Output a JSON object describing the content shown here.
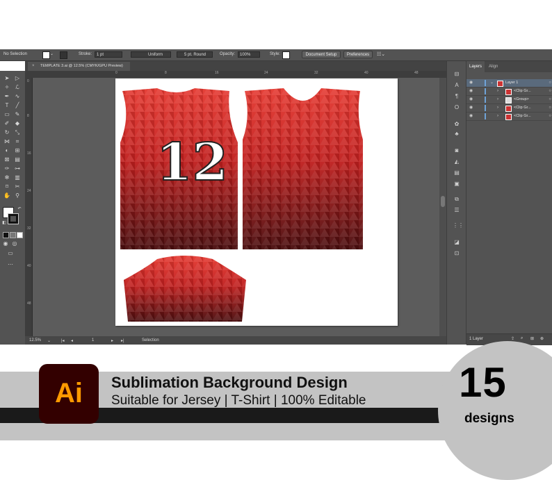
{
  "control_bar": {
    "selection": "No Selection",
    "stroke_label": "Stroke:",
    "stroke_value": "1 pt",
    "stroke_style": "Uniform",
    "brush": "5 pt. Round",
    "opacity_label": "Opacity:",
    "opacity_value": "100%",
    "style_label": "Style:",
    "document_setup": "Document Setup",
    "preferences": "Preferences"
  },
  "document_tab": {
    "title": "TEMPLATE 3.ai @ 12.5% (CMYK/GPU Preview)",
    "close": "×"
  },
  "ruler": {
    "h_ticks": [
      "0",
      "8",
      "16",
      "24",
      "32",
      "40",
      "48"
    ],
    "v_ticks": [
      "0",
      "8",
      "16",
      "24",
      "32",
      "40",
      "48"
    ]
  },
  "artboard": {
    "jersey_number": "12",
    "jersey_colors": {
      "light": "#e53a32",
      "mid": "#c1201f",
      "dark": "#4a0e0f"
    }
  },
  "status_bar": {
    "zoom": "12.5%",
    "artboard_num": "1",
    "tool": "Selection"
  },
  "layers_panel": {
    "tabs": [
      "Layers",
      "Align"
    ],
    "rows": [
      {
        "name": "Layer 1"
      },
      {
        "name": "<Clip Gr..."
      },
      {
        "name": "<Group>"
      },
      {
        "name": "<Clip Gr..."
      },
      {
        "name": "<Clip Gr..."
      }
    ],
    "footer": "1 Layer"
  },
  "banner": {
    "logo": "Ai",
    "title": "Sublimation Background Design",
    "subtitle": "Suitable for Jersey | T-Shirt | 100% Editable",
    "count": "15",
    "count_label": "designs"
  },
  "colors": {
    "ui_panel": "#535353",
    "canvas": "#5c5c5c",
    "accent_blue": "#6fa3d8",
    "ai_orange": "#ff9a00",
    "ai_bg": "#330000"
  }
}
